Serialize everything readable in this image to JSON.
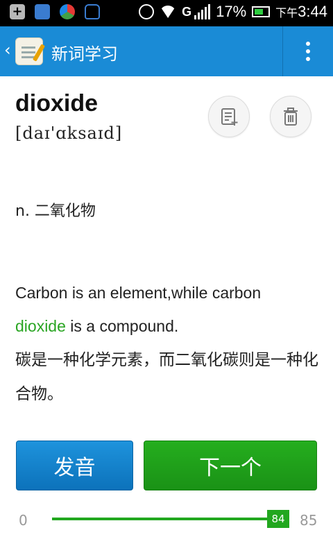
{
  "status_bar": {
    "network_type": "G",
    "battery_percent": "17%",
    "time_prefix": "下午",
    "time": "3:44"
  },
  "action_bar": {
    "title": "新词学习"
  },
  "word": {
    "text": "dioxide",
    "phonetic": "[daɪ'ɑksaɪd]",
    "meaning": "n. 二氧化物"
  },
  "example": {
    "en_part1": "Carbon is an element,while carbon",
    "en_highlight": "dioxide",
    "en_part2": " is a compound.",
    "cn": "碳是一种化学元素，而二氧化碳则是一种化合物。"
  },
  "buttons": {
    "speak_label": "发音",
    "next_label": "下一个"
  },
  "progress": {
    "min": "0",
    "max": "85",
    "current": "84",
    "current_value": 84,
    "max_value": 85
  },
  "colors": {
    "accent_blue": "#1a8bd6",
    "accent_green": "#22a71f"
  }
}
